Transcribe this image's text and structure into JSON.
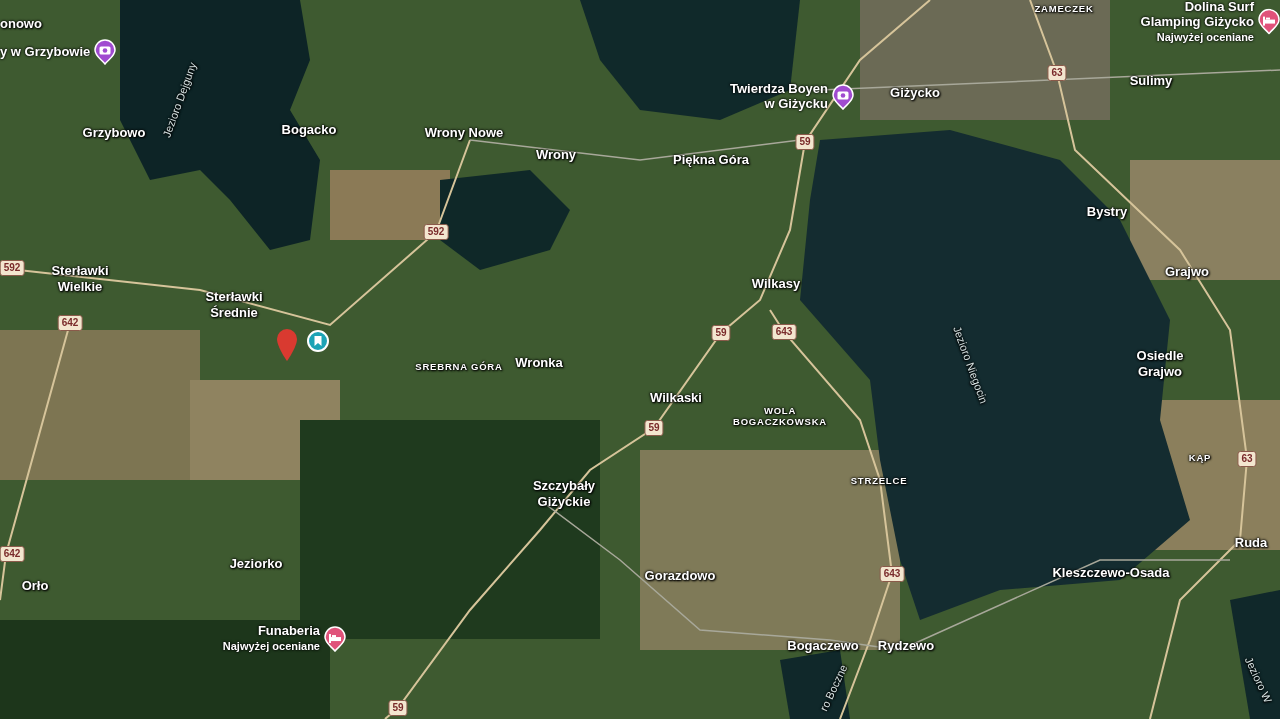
{
  "labels": [
    {
      "kind": "town",
      "lines": [
        "onowo"
      ]
    },
    {
      "kind": "lake",
      "lines": [
        "Jezioro Dejguny"
      ]
    },
    {
      "kind": "town",
      "lines": [
        "Grzybowo"
      ]
    },
    {
      "kind": "town",
      "lines": [
        "Bogacko"
      ]
    },
    {
      "kind": "town",
      "lines": [
        "Wrony Nowe"
      ]
    },
    {
      "kind": "town",
      "lines": [
        "Wrony"
      ]
    },
    {
      "kind": "town",
      "lines": [
        "Piękna Góra"
      ]
    },
    {
      "kind": "town",
      "lines": [
        "Giżycko"
      ]
    },
    {
      "kind": "district",
      "lines": [
        "ZAMECZEK"
      ]
    },
    {
      "kind": "town",
      "lines": [
        "Sulimy"
      ]
    },
    {
      "kind": "town",
      "lines": [
        "Bystry"
      ]
    },
    {
      "kind": "town",
      "lines": [
        "Grajwo"
      ]
    },
    {
      "kind": "town",
      "lines": [
        "Osiedle",
        "Grajwo"
      ]
    },
    {
      "kind": "town",
      "lines": [
        "Sterławki",
        "Wielkie"
      ]
    },
    {
      "kind": "town",
      "lines": [
        "Sterławki",
        "Średnie"
      ]
    },
    {
      "kind": "district",
      "lines": [
        "SREBRNA GÓRA"
      ]
    },
    {
      "kind": "town",
      "lines": [
        "Wronka"
      ]
    },
    {
      "kind": "town",
      "lines": [
        "Wilkasy"
      ]
    },
    {
      "kind": "lake",
      "lines": [
        "Jezioro Niegocin"
      ]
    },
    {
      "kind": "town",
      "lines": [
        "Wilkaski"
      ]
    },
    {
      "kind": "district",
      "lines": [
        "WOLA",
        "BOGACZKOWSKA"
      ]
    },
    {
      "kind": "district",
      "lines": [
        "STRZELCE"
      ]
    },
    {
      "kind": "district",
      "lines": [
        "KĄP"
      ]
    },
    {
      "kind": "town",
      "lines": [
        "Szczybały",
        "Giżyckie"
      ]
    },
    {
      "kind": "town",
      "lines": [
        "Gorazdowo"
      ]
    },
    {
      "kind": "town",
      "lines": [
        "Kleszczewo-Osada"
      ]
    },
    {
      "kind": "town",
      "lines": [
        "Ruda"
      ]
    },
    {
      "kind": "town",
      "lines": [
        "Jeziorko"
      ]
    },
    {
      "kind": "town",
      "lines": [
        "Orło"
      ]
    },
    {
      "kind": "town",
      "lines": [
        "Bogaczewo"
      ]
    },
    {
      "kind": "town",
      "lines": [
        "Rydzewo"
      ]
    },
    {
      "kind": "lake",
      "lines": [
        "ro Boczne"
      ]
    },
    {
      "kind": "lake",
      "lines": [
        "Jezioro W"
      ]
    }
  ],
  "pois": [
    {
      "kind": "attraction",
      "lines": [
        "y w Grzybowie"
      ]
    },
    {
      "kind": "attraction",
      "lines": [
        "Twierdza Boyen",
        "w Giżycku"
      ]
    },
    {
      "kind": "lodging",
      "lines": [
        "Dolina Surf",
        "Glamping Giżycko"
      ],
      "note": "Najwyżej oceniane"
    },
    {
      "kind": "lodging",
      "lines": [
        "Funaberia"
      ],
      "note": "Najwyżej oceniane"
    }
  ],
  "road_signs": [
    {
      "number": "592"
    },
    {
      "number": "592"
    },
    {
      "number": "642"
    },
    {
      "number": "642"
    },
    {
      "number": "59"
    },
    {
      "number": "63"
    },
    {
      "number": "59"
    },
    {
      "number": "643"
    },
    {
      "number": "59"
    },
    {
      "number": "63"
    },
    {
      "number": "643"
    },
    {
      "number": "59"
    }
  ]
}
